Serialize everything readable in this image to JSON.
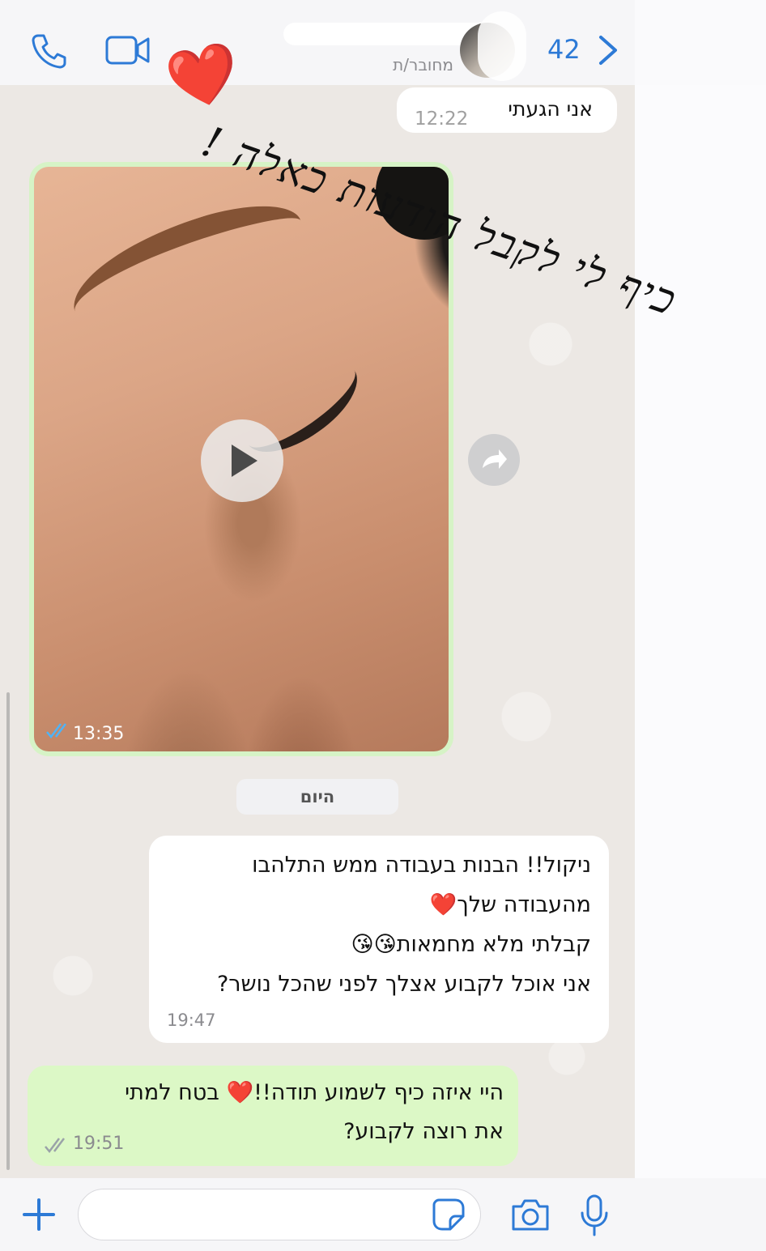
{
  "header": {
    "back_count": "42",
    "contact_status": "מחובר/ת"
  },
  "messages": {
    "arrived": {
      "text": "אני הגעתי",
      "time": "12:22"
    },
    "video": {
      "time": "13:35"
    },
    "date_separator": "היום",
    "incoming": {
      "lines": [
        "ניקול!! הבנות בעבודה ממש התלהבו",
        "מהעבודה שלך❤️",
        "קבלתי מלא מחמאות😘😘",
        "אני אוכל לקבוע אצלך לפני שהכל נושר?"
      ],
      "time": "19:47"
    },
    "outgoing": {
      "lines": [
        "היי איזה כיף לשמוע תודה!!❤️ בטח למתי",
        "את רוצה לקבוע?"
      ],
      "time": "19:51"
    }
  },
  "overlay": {
    "caption": "כיף לי לקבל הודעות כאלה !",
    "emoji": "❤️"
  },
  "colors": {
    "accent": "#2d7ad6",
    "outgoing_bubble": "#dcf8c6",
    "incoming_bubble": "#ffffff",
    "chat_background": "#ece8e4"
  }
}
